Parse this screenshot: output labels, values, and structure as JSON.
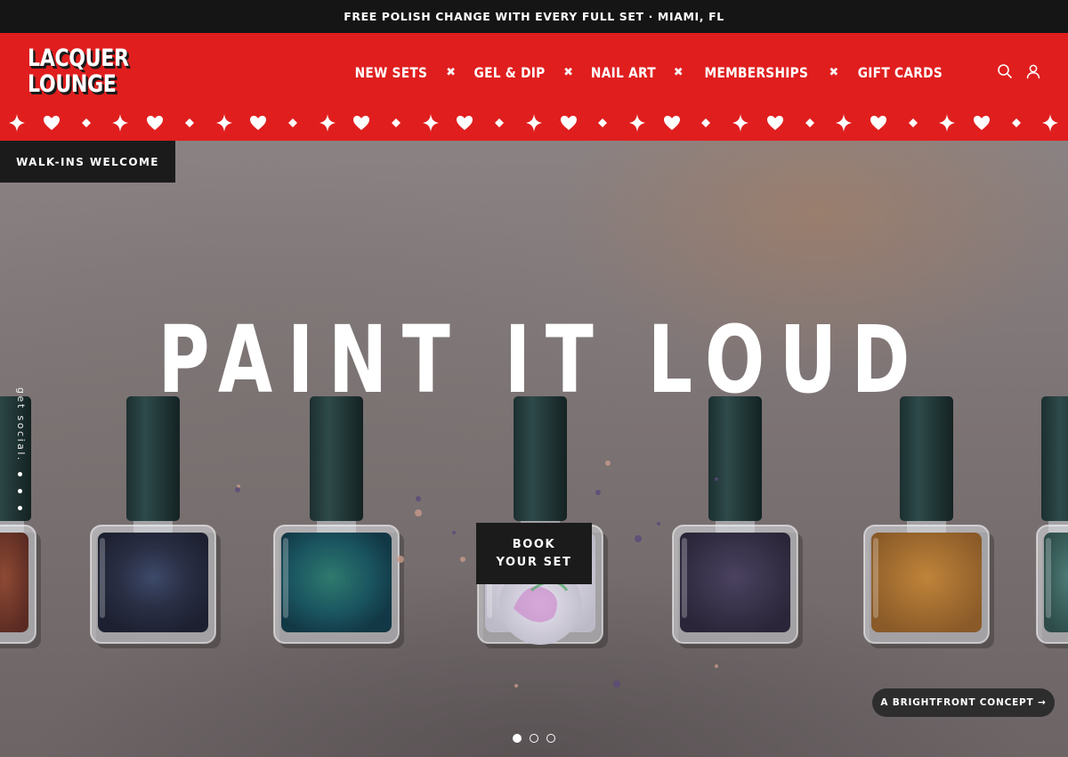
{
  "announcement": {
    "text": "FREE POLISH CHANGE WITH EVERY FULL SET · MIAMI, FL"
  },
  "brand": {
    "line1": "LACQUER",
    "line2": "LOUNGE",
    "color": "#e01e1e"
  },
  "nav": {
    "items": [
      {
        "label": "NEW SETS"
      },
      {
        "label": "GEL & DIP"
      },
      {
        "label": "NAIL ART"
      },
      {
        "label": "MEMBERSHIPS"
      },
      {
        "label": "GIFT CARDS"
      }
    ],
    "separator": "✖",
    "icons": [
      "search-icon",
      "account-icon"
    ]
  },
  "pattern": {
    "sequence": [
      "heart-icon",
      "diamond-icon",
      "sparkle-icon"
    ]
  },
  "hero": {
    "badge": "WALK-INS WELCOME",
    "headline": "PAINT IT LOUD",
    "cta_line1": "BOOK",
    "cta_line2": "YOUR SET",
    "social_label": "get social.",
    "concept_label": "A BRIGHTFRONT CONCEPT →",
    "slides": {
      "count": 3,
      "active": 1
    }
  }
}
